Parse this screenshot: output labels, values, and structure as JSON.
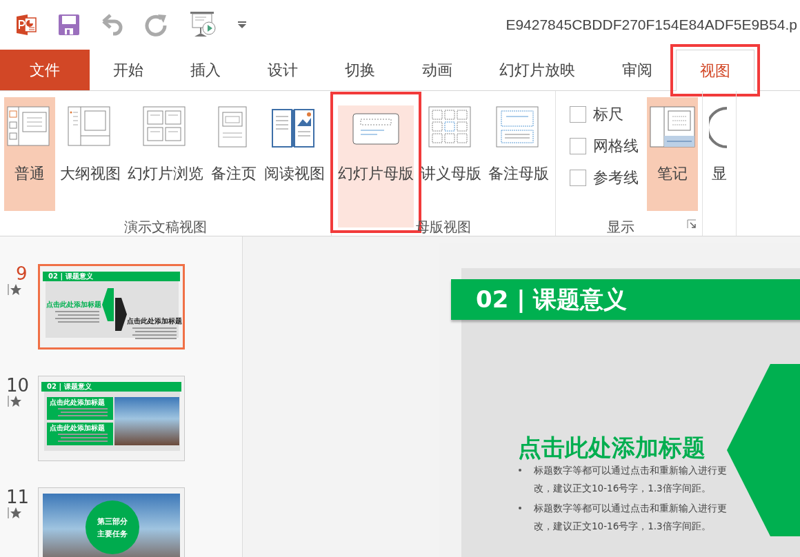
{
  "window": {
    "title": "E9427845CBDDF270F154E84ADF5E9B54.p"
  },
  "tabs": [
    {
      "label": "文件",
      "kind": "file",
      "selected": false,
      "highlighted": false
    },
    {
      "label": "开始",
      "kind": "tab",
      "selected": false,
      "highlighted": false
    },
    {
      "label": "插入",
      "kind": "tab",
      "selected": false,
      "highlighted": false
    },
    {
      "label": "设计",
      "kind": "tab",
      "selected": false,
      "highlighted": false
    },
    {
      "label": "切换",
      "kind": "tab",
      "selected": false,
      "highlighted": false
    },
    {
      "label": "动画",
      "kind": "tab",
      "selected": false,
      "highlighted": false
    },
    {
      "label": "幻灯片放映",
      "kind": "tab",
      "selected": false,
      "highlighted": false
    },
    {
      "label": "审阅",
      "kind": "tab",
      "selected": false,
      "highlighted": false
    },
    {
      "label": "视图",
      "kind": "tab",
      "selected": true,
      "highlighted": true
    }
  ],
  "ribbon": {
    "groups": [
      {
        "label": "演示文稿视图",
        "items": [
          {
            "kind": "button",
            "label": "普通",
            "selected": true,
            "hovered": false,
            "highlighted": false
          },
          {
            "kind": "button",
            "label": "大纲视图",
            "selected": false,
            "hovered": false,
            "highlighted": false
          },
          {
            "kind": "button",
            "label": "幻灯片浏览",
            "selected": false,
            "hovered": false,
            "highlighted": false
          },
          {
            "kind": "button",
            "label": "备注页",
            "selected": false,
            "hovered": false,
            "highlighted": false
          },
          {
            "kind": "button",
            "label": "阅读视图",
            "selected": false,
            "hovered": false,
            "highlighted": false
          }
        ]
      },
      {
        "label": "母版视图",
        "items": [
          {
            "kind": "button",
            "label": "幻灯片母版",
            "selected": false,
            "hovered": true,
            "highlighted": true
          },
          {
            "kind": "button",
            "label": "讲义母版",
            "selected": false,
            "hovered": false,
            "highlighted": false
          },
          {
            "kind": "button",
            "label": "备注母版",
            "selected": false,
            "hovered": false,
            "highlighted": false
          }
        ]
      },
      {
        "label": "显示",
        "launcher": true,
        "items": [
          {
            "kind": "checkbox",
            "label": "标尺",
            "checked": false
          },
          {
            "kind": "checkbox",
            "label": "网格线",
            "checked": false
          },
          {
            "kind": "checkbox",
            "label": "参考线",
            "checked": false
          },
          {
            "kind": "button",
            "label": "笔记",
            "selected": true,
            "hovered": false,
            "highlighted": false
          }
        ]
      },
      {
        "items": [
          {
            "kind": "button",
            "label": "显",
            "selected": false,
            "hovered": false,
            "highlighted": false
          }
        ]
      }
    ]
  },
  "slides": [
    {
      "number": "9",
      "selected": true,
      "kind": "hexagons",
      "title": "02 | 课题意义",
      "headings": [
        "点击此处添加标题",
        "点击此处添加标题"
      ]
    },
    {
      "number": "10",
      "selected": false,
      "kind": "boxes-photo",
      "title": "02 | 课题意义",
      "headings": [
        "点击此处添加标题",
        "点击此处添加标题"
      ]
    },
    {
      "number": "11",
      "selected": false,
      "kind": "section",
      "lines": [
        "第三部分",
        "主要任务"
      ]
    }
  ],
  "editor_slide": {
    "title": "02 | 课题意义",
    "heading": "点击此处添加标题",
    "bullets": [
      "标题数字等都可以通过点击和重新输入进行更改，建议正文10-16号字，1.3倍字间距。",
      "标题数字等都可以通过点击和重新输入进行更改，建议正文10-16号字，1.3倍字间距。"
    ]
  }
}
